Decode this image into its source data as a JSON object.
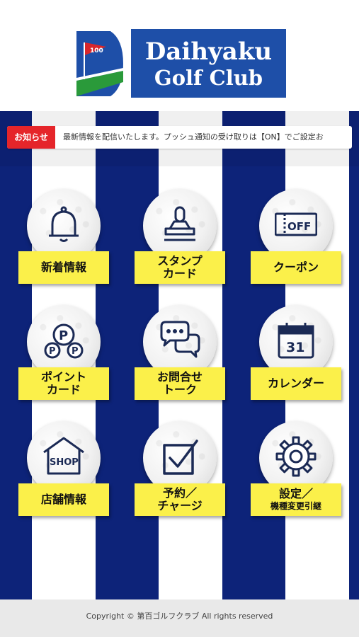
{
  "logo": {
    "line1": "Daihyaku",
    "line2": "Golf Club",
    "flag_text": "100"
  },
  "notice": {
    "badge": "お知らせ",
    "text": "最新情報を配信いたします。プッシュ通知の受け取りは【ON】でご設定お"
  },
  "menu": [
    {
      "line1": "新着情報",
      "line2": ""
    },
    {
      "line1": "スタンプ",
      "line2": "カード"
    },
    {
      "line1": "クーポン",
      "line2": "",
      "icon_text": "OFF"
    },
    {
      "line1": "ポイント",
      "line2": "カード",
      "icon_text": "P"
    },
    {
      "line1": "お問合せ",
      "line2": "トーク"
    },
    {
      "line1": "カレンダー",
      "line2": "",
      "icon_text": "31"
    },
    {
      "line1": "店舗情報",
      "line2": "",
      "icon_text": "SHOP"
    },
    {
      "line1": "予約／",
      "line2": "チャージ"
    },
    {
      "line1": "設定／",
      "line2": "機種変更引継"
    }
  ],
  "footer": {
    "copyright": "Copyright © 第百ゴルフクラブ All rights reserved"
  },
  "colors": {
    "navy": "#0d2379",
    "logo_blue": "#1e4fa8",
    "badge_red": "#e5252a",
    "label_yellow": "#fbf04a",
    "icon_navy": "#1b2a55"
  }
}
